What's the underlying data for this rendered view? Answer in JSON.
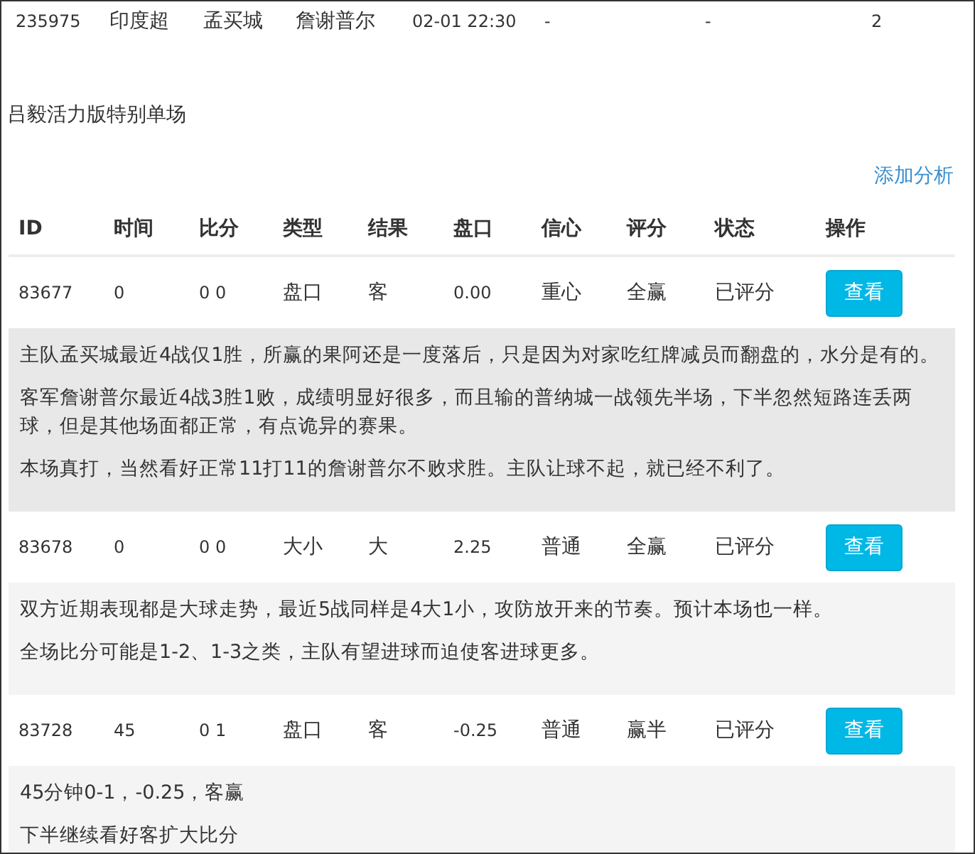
{
  "match": {
    "cells": [
      "235975",
      "印度超",
      "孟买城",
      "詹谢普尔",
      "02-01 22:30",
      "-",
      "-",
      "2"
    ]
  },
  "title": "吕毅活力版特别单场",
  "add_link": "添加分析",
  "table": {
    "columns": [
      "ID",
      "时间",
      "比分",
      "类型",
      "结果",
      "盘口",
      "信心",
      "评分",
      "状态",
      "操作"
    ],
    "rows": [
      {
        "cells": [
          "83677",
          "0",
          "0 0",
          "盘口",
          "客",
          "0.00",
          "重心",
          "全赢",
          "已评分"
        ],
        "button": "查看",
        "highlighted": true,
        "notes": [
          "主队孟买城最近4战仅1胜，所赢的果阿还是一度落后，只是因为对家吃红牌减员而翻盘的，水分是有的。",
          "客军詹谢普尔最近4战3胜1败，成绩明显好很多，而且输的普纳城一战领先半场，下半忽然短路连丢两球，但是其他场面都正常，有点诡异的赛果。",
          "本场真打，当然看好正常11打11的詹谢普尔不败求胜。主队让球不起，就已经不利了。"
        ]
      },
      {
        "cells": [
          "83678",
          "0",
          "0 0",
          "大小",
          "大",
          "2.25",
          "普通",
          "全赢",
          "已评分"
        ],
        "button": "查看",
        "highlighted": false,
        "notes": [
          "双方近期表现都是大球走势，最近5战同样是4大1小，攻防放开来的节奏。预计本场也一样。",
          "全场比分可能是1-2、1-3之类，主队有望进球而迫使客进球更多。"
        ]
      },
      {
        "cells": [
          "83728",
          "45",
          "0 1",
          "盘口",
          "客",
          "-0.25",
          "普通",
          "赢半",
          "已评分"
        ],
        "button": "查看",
        "highlighted": false,
        "notes": [
          "45分钟0-1，-0.25，客赢",
          "下半继续看好客扩大比分"
        ]
      }
    ]
  }
}
